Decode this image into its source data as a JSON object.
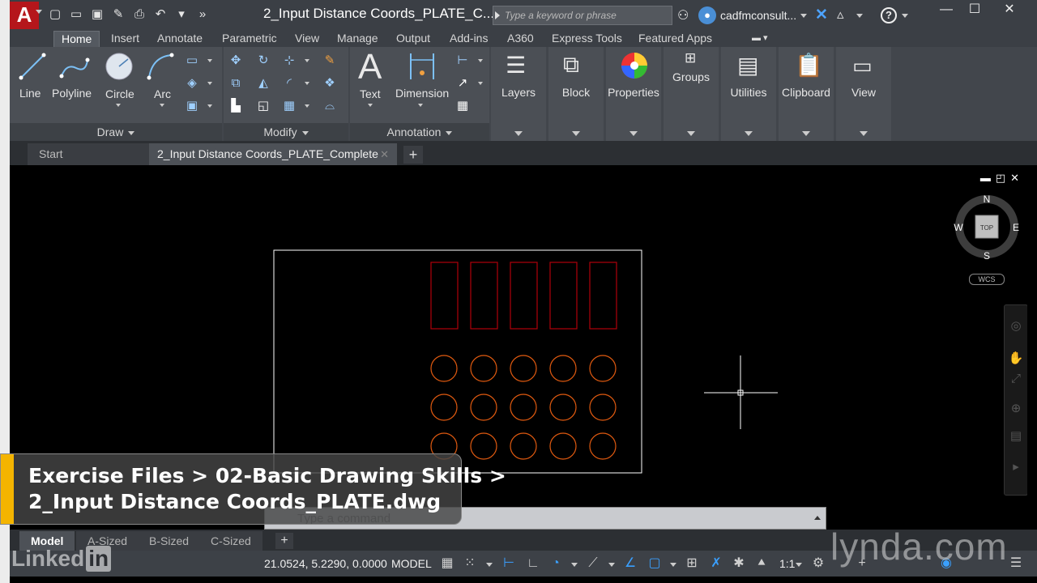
{
  "window": {
    "doc_title": "2_Input Distance Coords_PLATE_C...",
    "search_placeholder": "Type a keyword or phrase",
    "user_name": "cadfmconsult...",
    "app_letter": "A"
  },
  "ribbon_tabs": [
    "Home",
    "Insert",
    "Annotate",
    "Parametric",
    "View",
    "Manage",
    "Output",
    "Add-ins",
    "A360",
    "Express Tools",
    "Featured Apps"
  ],
  "draw_panel": {
    "title": "Draw",
    "tools": [
      "Line",
      "Polyline",
      "Circle",
      "Arc"
    ]
  },
  "modify_panel": {
    "title": "Modify"
  },
  "annotation_panel": {
    "title": "Annotation",
    "tools": [
      "Text",
      "Dimension"
    ]
  },
  "big_panels": [
    "Layers",
    "Block",
    "Properties",
    "Groups",
    "Utilities",
    "Clipboard",
    "View"
  ],
  "file_tabs": {
    "start": "Start",
    "active": "2_Input Distance Coords_PLATE_Complete"
  },
  "viewcube": {
    "n": "N",
    "s": "S",
    "e": "E",
    "w": "W",
    "face": "TOP",
    "wcs": "WCS"
  },
  "drawing": {
    "rect_color": "#b0000a",
    "circle_color": "#e05a10",
    "outline_color": "#ffffff",
    "slot_count": 5,
    "circle_rows": 3,
    "circle_cols": 5
  },
  "command_line": {
    "placeholder": "Type a command"
  },
  "layout_tabs": [
    "Model",
    "A-Sized",
    "B-Sized",
    "C-Sized"
  ],
  "status": {
    "coords": "21.0524, 5.2290, 0.0000",
    "model": "MODEL",
    "scale": "1:1"
  },
  "caption": {
    "line1": "Exercise Files > 02-Basic Drawing Skills >",
    "line2": "2_Input Distance Coords_PLATE.dwg"
  },
  "watermarks": {
    "left": "Linked",
    "left_in": "in",
    "right": "lynda.com"
  },
  "colors": {
    "accent": "#3aa0ff",
    "caption_bar": "#f4b400",
    "app_red": "#b5161b"
  }
}
